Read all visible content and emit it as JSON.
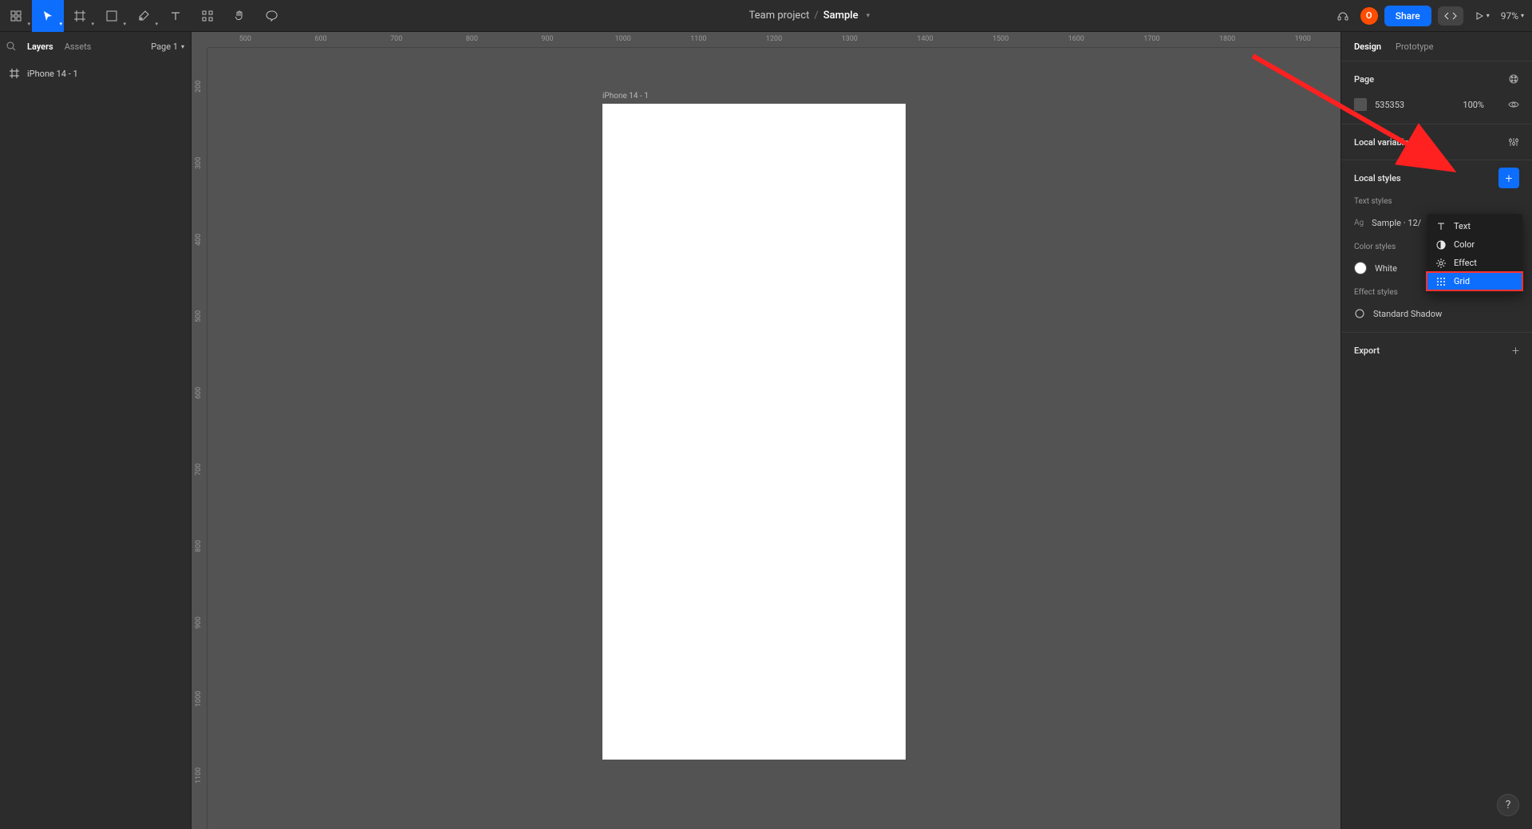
{
  "toolbar": {
    "project": "Team project",
    "file": "Sample",
    "share": "Share",
    "zoom": "97%",
    "avatar_initial": "O"
  },
  "left_panel": {
    "tab_layers": "Layers",
    "tab_assets": "Assets",
    "page_label": "Page 1",
    "layer_name": "iPhone 14 - 1"
  },
  "canvas": {
    "frame_label": "iPhone 14 - 1",
    "ruler_h": [
      "500",
      "600",
      "700",
      "800",
      "900",
      "1000",
      "1100",
      "1200",
      "1300",
      "1400",
      "1500",
      "1600",
      "1700",
      "1800",
      "1900"
    ],
    "ruler_v": [
      "200",
      "300",
      "400",
      "500",
      "600",
      "700",
      "800",
      "900",
      "1000",
      "1100"
    ]
  },
  "right_panel": {
    "tab_design": "Design",
    "tab_prototype": "Prototype",
    "page_section": "Page",
    "bg_hex": "535353",
    "bg_opacity": "100%",
    "local_variables": "Local variables",
    "local_styles": "Local styles",
    "text_styles": "Text styles",
    "sample_style": "Sample · 12/",
    "color_styles": "Color styles",
    "white_style": "White",
    "effect_styles": "Effect styles",
    "shadow_style": "Standard Shadow",
    "export": "Export"
  },
  "popup": {
    "text": "Text",
    "color": "Color",
    "effect": "Effect",
    "grid": "Grid"
  },
  "help": "?"
}
